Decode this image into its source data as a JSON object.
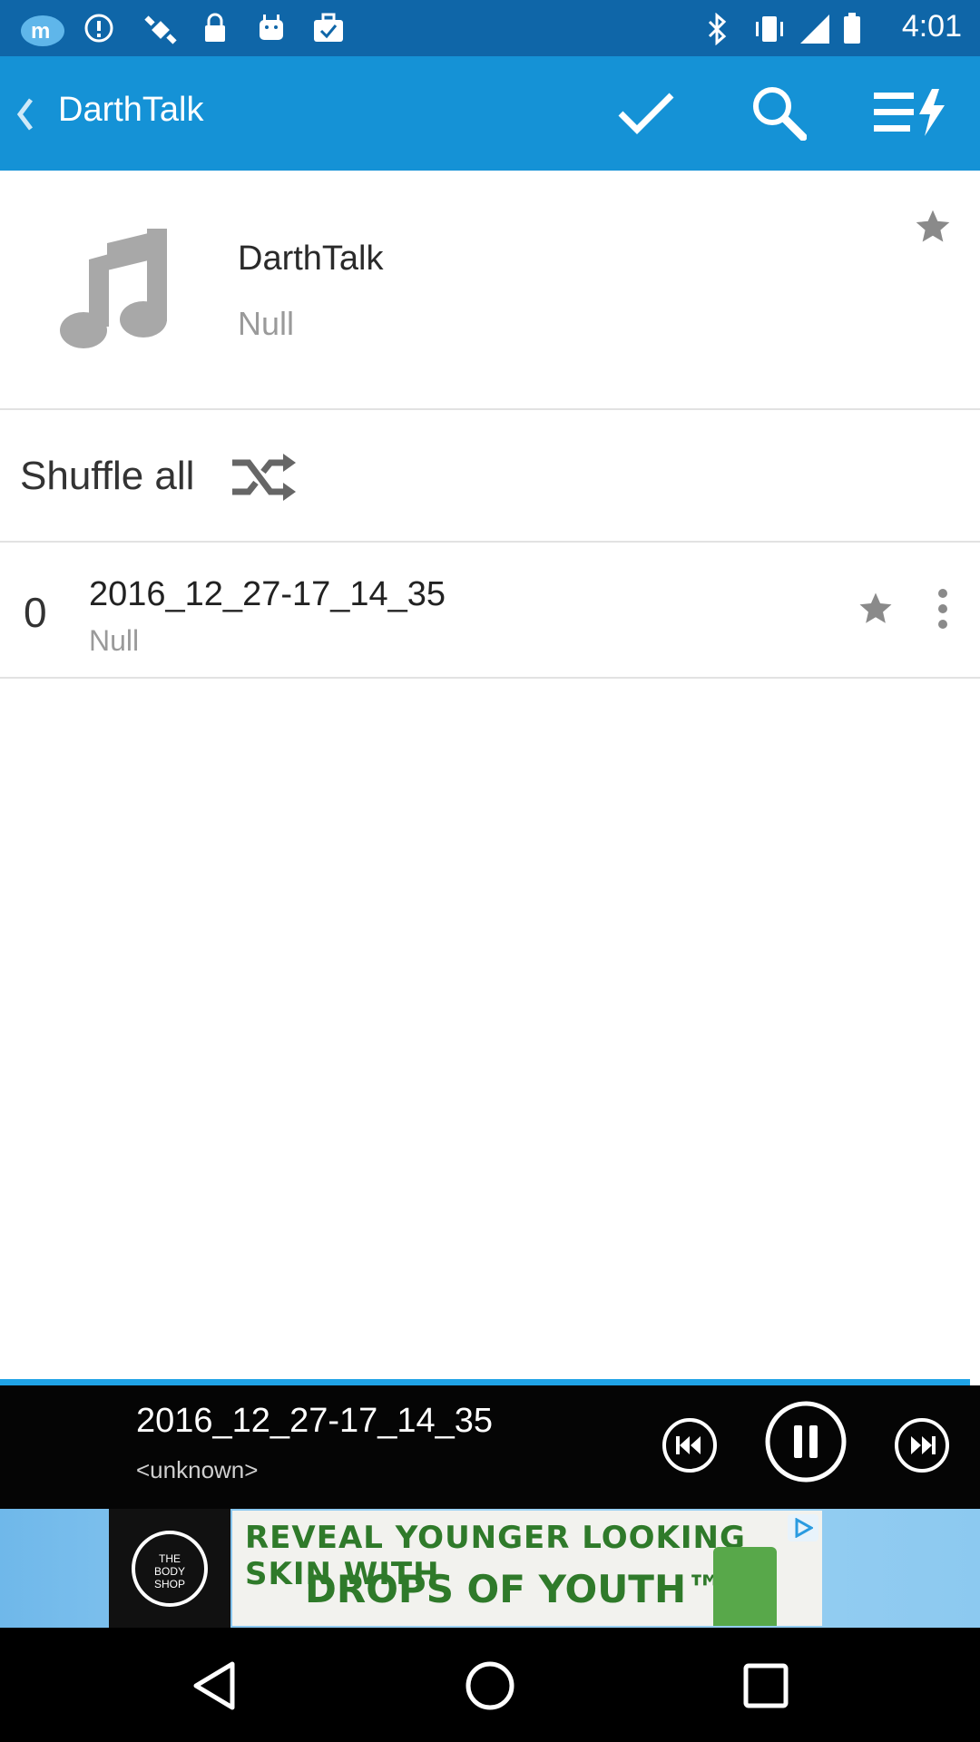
{
  "status_bar": {
    "time": "4:01",
    "icons": [
      "app-m-icon",
      "alert-icon",
      "fake-gps-icon",
      "lock-icon",
      "android-icon",
      "briefcase-check-icon",
      "bluetooth-icon",
      "vibrate-icon",
      "signal-icon",
      "battery-icon"
    ]
  },
  "app_bar": {
    "title": "DarthTalk",
    "actions": [
      "check-icon",
      "search-icon",
      "queue-icon"
    ],
    "accent": "#1592d6"
  },
  "header": {
    "title": "DarthTalk",
    "subtitle": "Null"
  },
  "shuffle": {
    "label": "Shuffle all"
  },
  "tracks": [
    {
      "number": "0",
      "title": "2016_12_27-17_14_35",
      "subtitle": "Null"
    }
  ],
  "player": {
    "title": "2016_12_27-17_14_35",
    "subtitle": "<unknown>",
    "progress": 0.99
  },
  "ad": {
    "line1": "REVEAL YOUNGER LOOKING SKIN WITH",
    "line2": "DROPS OF YOUTH™",
    "logo_text": "THE BODY SHOP"
  }
}
